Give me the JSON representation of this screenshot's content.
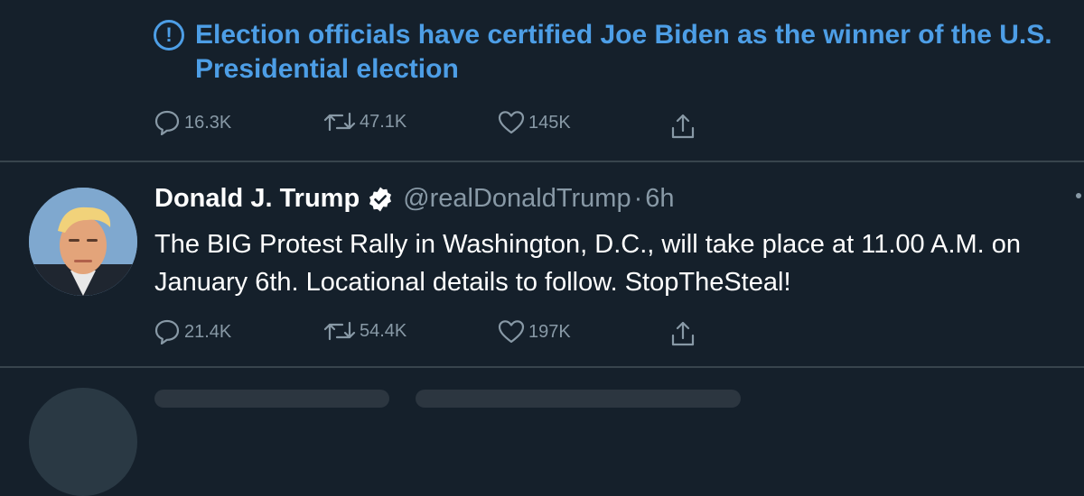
{
  "notice": {
    "icon": "info-circle-icon",
    "icon_glyph": "!",
    "text": "Election officials have certified Joe Biden as the winner of the U.S. Presidential election",
    "color": "#4d9ee6"
  },
  "actions_1": {
    "reply_count": "16.3K",
    "retweet_count": "47.1K",
    "like_count": "145K"
  },
  "tweet": {
    "name": "Donald J. Trump",
    "handle": "@realDonaldTrump",
    "separator": "·",
    "time": "6h",
    "text": "The BIG Protest Rally in Washington, D.C., will take place at 11.00 A.M. on January 6th. Locational details to follow. StopTheSteal!",
    "reply_count": "21.4K",
    "retweet_count": "54.4K",
    "like_count": "197K"
  },
  "colors": {
    "background": "#15202b",
    "muted": "#8899a6",
    "divider": "#38444d"
  }
}
